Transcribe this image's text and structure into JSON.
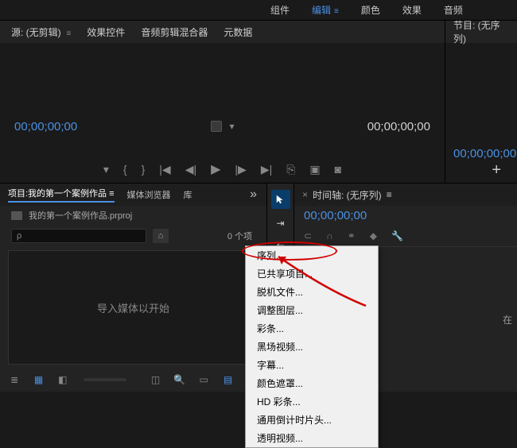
{
  "topbar": {
    "tabs": [
      {
        "label": "组件"
      },
      {
        "label": "编辑",
        "active": true
      },
      {
        "label": "颜色"
      },
      {
        "label": "效果"
      },
      {
        "label": "音频"
      }
    ]
  },
  "source": {
    "title": "源: (无剪辑)",
    "tabs": [
      "效果控件",
      "音频剪辑混合器",
      "元数据"
    ],
    "timecode_left": "00;00;00;00",
    "timecode_right": "00;00;00;00"
  },
  "program": {
    "title": "节目: (无序列)",
    "timecode": "00;00;00;00"
  },
  "project": {
    "tab_label": "项目:我的第一个案例作品",
    "tab_browser": "媒体浏览器",
    "tab_lib": "库",
    "file_name": "我的第一个案例作品.prproj",
    "search_placeholder": "ρ",
    "item_count": "0 个项",
    "empty_text": "导入媒体以开始"
  },
  "timeline": {
    "title": "时间轴: (无序列)",
    "timecode": "00;00;00;00",
    "side_text": "在"
  },
  "context_menu": {
    "items": [
      "序列...",
      "已共享项目...",
      "脱机文件...",
      "调整图层...",
      "彩条...",
      "黑场视频...",
      "字幕...",
      "颜色遮罩...",
      "HD 彩条...",
      "通用倒计时片头...",
      "透明视频..."
    ]
  }
}
